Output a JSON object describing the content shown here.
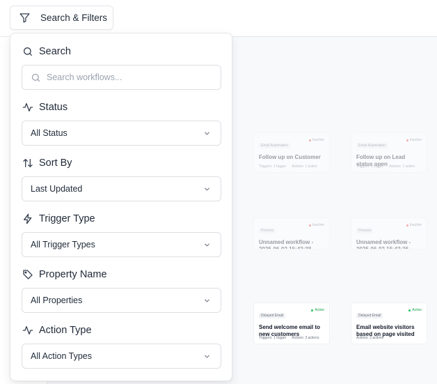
{
  "toolbar": {
    "filters_button_label": "Search & Filters",
    "filters_icon": "filter-funnel-icon"
  },
  "panel": {
    "search": {
      "label": "Search",
      "placeholder": "Search workflows...",
      "value": ""
    },
    "status": {
      "label": "Status",
      "selected": "All Status"
    },
    "sort_by": {
      "label": "Sort By",
      "selected": "Last Updated"
    },
    "trigger_type": {
      "label": "Trigger Type",
      "selected": "All Trigger Types"
    },
    "property_name": {
      "label": "Property Name",
      "selected": "All Properties"
    },
    "action_type": {
      "label": "Action Type",
      "selected": "All Action Types"
    }
  },
  "cards": [
    {
      "tag": "Email Automation",
      "status": "Inactive",
      "status_color": "#ef4444",
      "title": "Follow up on Customer",
      "triggers": "Triggers: 1 trigger",
      "actions": "Actions: 1 action",
      "faded": true
    },
    {
      "tag": "Email Automation",
      "status": "Inactive",
      "status_color": "#ef4444",
      "title": "Follow up on Lead status open",
      "triggers": "Triggers: 1 trigger",
      "actions": "Actions: 1 action",
      "faded": true
    },
    {
      "tag": "Process",
      "status": "Inactive",
      "status_color": "#ef4444",
      "title": "Unnamed workflow - 2025-06-02 15:43:38...",
      "triggers": "",
      "actions": "",
      "faded": true
    },
    {
      "tag": "Process",
      "status": "Inactive",
      "status_color": "#ef4444",
      "title": "Unnamed workflow - 2025-06-02 15:43:36...",
      "triggers": "",
      "actions": "",
      "faded": true
    },
    {
      "tag": "Delayed Email",
      "status": "Active",
      "status_color": "#22c55e",
      "title": "Send welcome email to new customers",
      "triggers": "Triggers: 1 trigger",
      "actions": "Actions: 3 actions",
      "faded": false
    },
    {
      "tag": "Delayed Email",
      "status": "Active",
      "status_color": "#22c55e",
      "title": "Email website visitors based on page visited",
      "triggers": "",
      "actions": "Actions: 3 actions",
      "faded": false
    }
  ]
}
